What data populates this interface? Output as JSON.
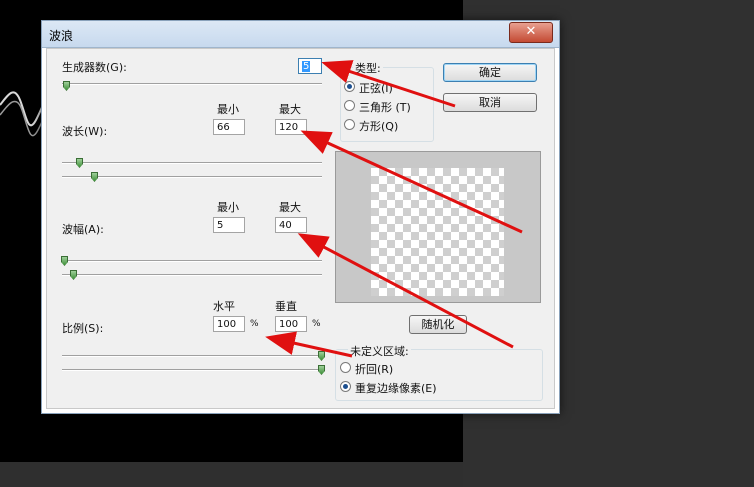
{
  "dialog": {
    "title": "波浪",
    "close_symbol": "✕"
  },
  "generators": {
    "label": "生成器数(G):",
    "value": "5"
  },
  "type_group": {
    "title": "类型:",
    "options": [
      {
        "label": "正弦(I)",
        "selected": true
      },
      {
        "label": "三角形 (T)",
        "selected": false
      },
      {
        "label": "方形(Q)",
        "selected": false
      }
    ]
  },
  "buttons": {
    "ok": "确定",
    "cancel": "取消",
    "randomize": "随机化"
  },
  "wavelength": {
    "label": "波长(W):",
    "min_header": "最小",
    "max_header": "最大",
    "min": "66",
    "max": "120"
  },
  "amplitude": {
    "label": "波幅(A):",
    "min_header": "最小",
    "max_header": "最大",
    "min": "5",
    "max": "40"
  },
  "scale": {
    "label": "比例(S):",
    "h_header": "水平",
    "v_header": "垂直",
    "h": "100",
    "v": "100",
    "unit": "%"
  },
  "undefined_areas": {
    "title": "未定义区域:",
    "options": [
      {
        "label": "折回(R)",
        "selected": false
      },
      {
        "label": "重复边缘像素(E)",
        "selected": true
      }
    ]
  },
  "colors": {
    "annotation_arrow": "#e01010",
    "slider_thumb": "#4a9a44",
    "title_bar": "#c7d9ee"
  }
}
